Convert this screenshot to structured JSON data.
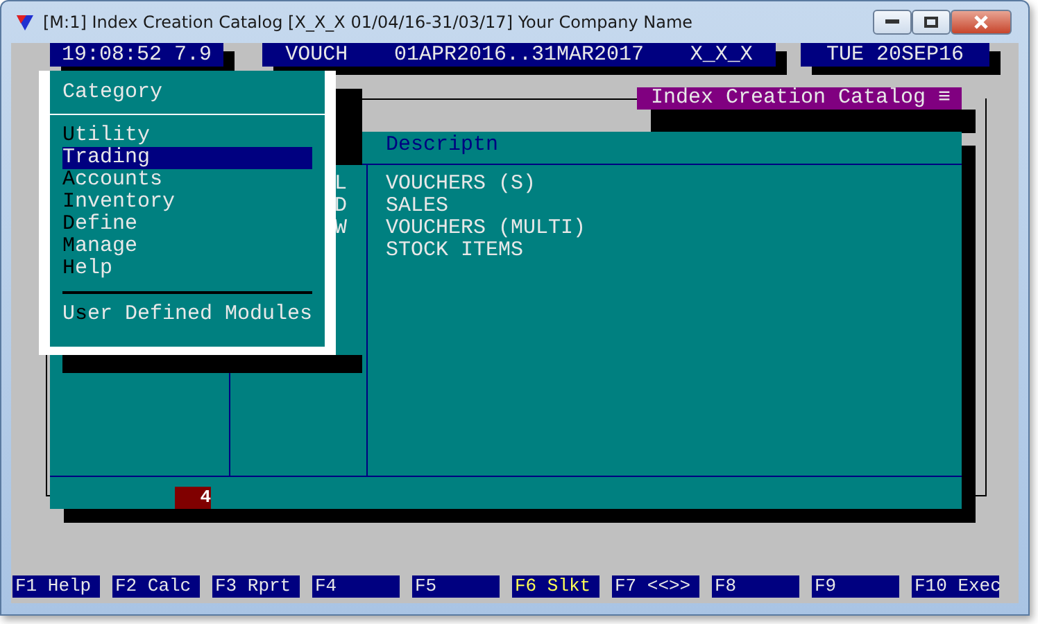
{
  "window": {
    "title": "[M:1] Index Creation Catalog [X_X_X 01/04/16-31/03/17] Your Company Name"
  },
  "header_bars": [
    {
      "items": [
        "19:08:52 7.9"
      ]
    },
    {
      "items": [
        "VOUCH",
        "01APR2016..31MAR2017",
        "X_X_X"
      ]
    },
    {
      "items": [
        "TUE 20SEP16"
      ]
    }
  ],
  "catalog": {
    "title": "Index Creation Catalog ≡",
    "column_header": "Descriptn",
    "column_2_values": [
      "L",
      "D",
      "W"
    ],
    "rows": [
      "VOUCHERS (S)",
      "SALES",
      "VOUCHERS (MULTI)",
      "STOCK ITEMS"
    ],
    "count": "4"
  },
  "menu": {
    "title": "Category",
    "items": [
      {
        "selected": false,
        "parts": [
          {
            "text": "U",
            "hotkey": true
          },
          {
            "text": "tility",
            "hotkey": false
          }
        ]
      },
      {
        "selected": true,
        "parts": [
          {
            "text": "Trading",
            "hotkey": false
          }
        ]
      },
      {
        "selected": false,
        "parts": [
          {
            "text": "A",
            "hotkey": true
          },
          {
            "text": "ccounts",
            "hotkey": false
          }
        ]
      },
      {
        "selected": false,
        "parts": [
          {
            "text": "I",
            "hotkey": true
          },
          {
            "text": "nventory",
            "hotkey": false
          }
        ]
      },
      {
        "selected": false,
        "parts": [
          {
            "text": "D",
            "hotkey": true
          },
          {
            "text": "efine",
            "hotkey": false
          }
        ]
      },
      {
        "selected": false,
        "parts": [
          {
            "text": "M",
            "hotkey": true
          },
          {
            "text": "anage",
            "hotkey": false
          }
        ]
      },
      {
        "selected": false,
        "parts": [
          {
            "text": "H",
            "hotkey": true
          },
          {
            "text": "elp",
            "hotkey": false
          }
        ]
      }
    ],
    "extra": {
      "selected": false,
      "parts": [
        {
          "text": "U",
          "hotkey": false
        },
        {
          "text": "s",
          "hotkey": true
        },
        {
          "text": "er Defined Modules",
          "hotkey": false
        }
      ]
    }
  },
  "function_keys": [
    {
      "label": "F1 Help",
      "highlighted": false
    },
    {
      "label": "F2 Calc",
      "highlighted": false
    },
    {
      "label": "F3 Rprt",
      "highlighted": false
    },
    {
      "label": "F4",
      "highlighted": false
    },
    {
      "label": "F5",
      "highlighted": false
    },
    {
      "label": "F6 Slkt",
      "highlighted": true
    },
    {
      "label": "F7 <<>>",
      "highlighted": false
    },
    {
      "label": "F8",
      "highlighted": false
    },
    {
      "label": "F9",
      "highlighted": false
    },
    {
      "label": "F10 Exec",
      "highlighted": false
    }
  ]
}
